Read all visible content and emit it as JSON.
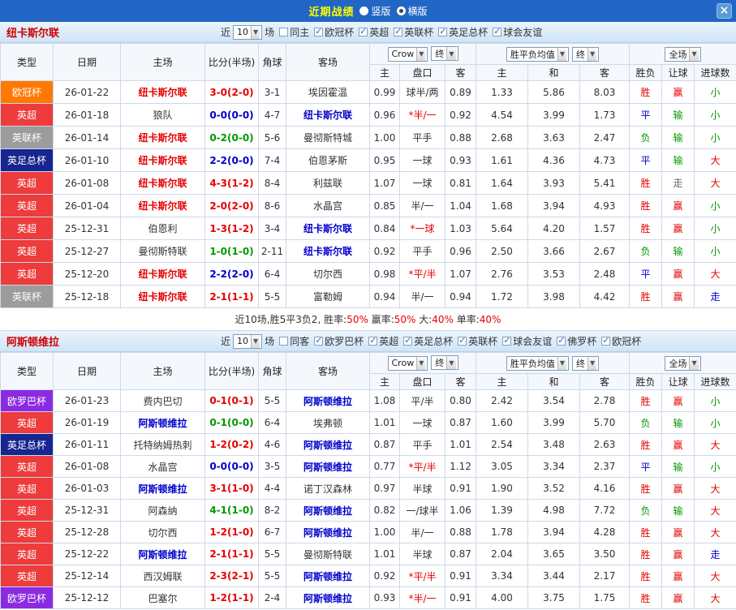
{
  "topbar": {
    "title": "近期战绩",
    "radios": [
      {
        "label": "竖版",
        "selected": false
      },
      {
        "label": "横版",
        "selected": true
      }
    ],
    "close_label": "×"
  },
  "colors": {
    "win_red": "#e60000",
    "draw_blue": "#0000cc",
    "loss_green": "#009900",
    "neutral": "#333333",
    "void_gray": "#666666"
  },
  "sections": [
    {
      "team": "纽卡斯尔联",
      "recent_prefix": "近",
      "recent_count": "10",
      "recent_suffix": "场",
      "same_filter": {
        "label": "同主",
        "checked": false
      },
      "cups": [
        {
          "label": "欧冠杯",
          "checked": true
        },
        {
          "label": "英超",
          "checked": true
        },
        {
          "label": "英联杯",
          "checked": true
        },
        {
          "label": "英足总杯",
          "checked": true
        },
        {
          "label": "球会友谊",
          "checked": true
        }
      ],
      "selects": {
        "bookmaker": "Crow",
        "ah_stage": "终",
        "avg_label": "胜平负均值",
        "avg_stage": "终",
        "scope": "全场"
      },
      "headers": {
        "type": "类型",
        "date": "日期",
        "home": "主场",
        "score": "比分(半场)",
        "corners": "角球",
        "away": "客场",
        "ah": [
          "主",
          "盘口",
          "客"
        ],
        "avg": [
          "主",
          "和",
          "客"
        ],
        "results": [
          "胜负",
          "让球",
          "进球数"
        ]
      },
      "rows": [
        {
          "comp": "欧冠杯",
          "comp_bg": "#ff7800",
          "date": "26-01-22",
          "home": "纽卡斯尔联",
          "home_color": "#e60000",
          "score": "3-0(2-0)",
          "score_color": "#e60000",
          "corners": "3-1",
          "away": "埃因霍温",
          "away_color": "#333333",
          "ah": [
            "0.99",
            "球半/两",
            "0.89"
          ],
          "ah_line_color": "#333333",
          "avg": [
            "1.33",
            "5.86",
            "8.03"
          ],
          "res": [
            [
              "胜",
              "#e60000"
            ],
            [
              "赢",
              "#e60000"
            ],
            [
              "小",
              "#009900"
            ]
          ]
        },
        {
          "comp": "英超",
          "comp_bg": "#ee3b3b",
          "date": "26-01-18",
          "home": "狼队",
          "home_color": "#333333",
          "score": "0-0(0-0)",
          "score_color": "#0000cc",
          "corners": "4-7",
          "away": "纽卡斯尔联",
          "away_color": "#0000cc",
          "ah": [
            "0.96",
            "*半/一",
            "0.92"
          ],
          "ah_line_color": "#e60000",
          "avg": [
            "4.54",
            "3.99",
            "1.73"
          ],
          "res": [
            [
              "平",
              "#0000cc"
            ],
            [
              "输",
              "#009900"
            ],
            [
              "小",
              "#009900"
            ]
          ]
        },
        {
          "comp": "英联杯",
          "comp_bg": "#9c9c9c",
          "date": "26-01-14",
          "home": "纽卡斯尔联",
          "home_color": "#e60000",
          "score": "0-2(0-0)",
          "score_color": "#009900",
          "corners": "5-6",
          "away": "曼彻斯特城",
          "away_color": "#333333",
          "ah": [
            "1.00",
            "平手",
            "0.88"
          ],
          "ah_line_color": "#333333",
          "avg": [
            "2.68",
            "3.63",
            "2.47"
          ],
          "res": [
            [
              "负",
              "#009900"
            ],
            [
              "输",
              "#009900"
            ],
            [
              "小",
              "#009900"
            ]
          ]
        },
        {
          "comp": "英足总杯",
          "comp_bg": "#16258f",
          "date": "26-01-10",
          "home": "纽卡斯尔联",
          "home_color": "#e60000",
          "score": "2-2(0-0)",
          "score_color": "#0000cc",
          "corners": "7-4",
          "away": "伯恩茅斯",
          "away_color": "#333333",
          "ah": [
            "0.95",
            "一球",
            "0.93"
          ],
          "ah_line_color": "#333333",
          "avg": [
            "1.61",
            "4.36",
            "4.73"
          ],
          "res": [
            [
              "平",
              "#0000cc"
            ],
            [
              "输",
              "#009900"
            ],
            [
              "大",
              "#e60000"
            ]
          ]
        },
        {
          "comp": "英超",
          "comp_bg": "#ee3b3b",
          "date": "26-01-08",
          "home": "纽卡斯尔联",
          "home_color": "#e60000",
          "score": "4-3(1-2)",
          "score_color": "#e60000",
          "corners": "8-4",
          "away": "利兹联",
          "away_color": "#333333",
          "ah": [
            "1.07",
            "一球",
            "0.81"
          ],
          "ah_line_color": "#333333",
          "avg": [
            "1.64",
            "3.93",
            "5.41"
          ],
          "res": [
            [
              "胜",
              "#e60000"
            ],
            [
              "走",
              "#666666"
            ],
            [
              "大",
              "#e60000"
            ]
          ]
        },
        {
          "comp": "英超",
          "comp_bg": "#ee3b3b",
          "date": "26-01-04",
          "home": "纽卡斯尔联",
          "home_color": "#e60000",
          "score": "2-0(2-0)",
          "score_color": "#e60000",
          "corners": "8-6",
          "away": "水晶宫",
          "away_color": "#333333",
          "ah": [
            "0.85",
            "半/一",
            "1.04"
          ],
          "ah_line_color": "#333333",
          "avg": [
            "1.68",
            "3.94",
            "4.93"
          ],
          "res": [
            [
              "胜",
              "#e60000"
            ],
            [
              "赢",
              "#e60000"
            ],
            [
              "小",
              "#009900"
            ]
          ]
        },
        {
          "comp": "英超",
          "comp_bg": "#ee3b3b",
          "date": "25-12-31",
          "home": "伯恩利",
          "home_color": "#333333",
          "score": "1-3(1-2)",
          "score_color": "#e60000",
          "corners": "3-4",
          "away": "纽卡斯尔联",
          "away_color": "#0000cc",
          "ah": [
            "0.84",
            "*一球",
            "1.03"
          ],
          "ah_line_color": "#e60000",
          "avg": [
            "5.64",
            "4.20",
            "1.57"
          ],
          "res": [
            [
              "胜",
              "#e60000"
            ],
            [
              "赢",
              "#e60000"
            ],
            [
              "小",
              "#009900"
            ]
          ]
        },
        {
          "comp": "英超",
          "comp_bg": "#ee3b3b",
          "date": "25-12-27",
          "home": "曼彻斯特联",
          "home_color": "#333333",
          "score": "1-0(1-0)",
          "score_color": "#009900",
          "corners": "2-11",
          "away": "纽卡斯尔联",
          "away_color": "#0000cc",
          "ah": [
            "0.92",
            "平手",
            "0.96"
          ],
          "ah_line_color": "#333333",
          "avg": [
            "2.50",
            "3.66",
            "2.67"
          ],
          "res": [
            [
              "负",
              "#009900"
            ],
            [
              "输",
              "#009900"
            ],
            [
              "小",
              "#009900"
            ]
          ]
        },
        {
          "comp": "英超",
          "comp_bg": "#ee3b3b",
          "date": "25-12-20",
          "home": "纽卡斯尔联",
          "home_color": "#e60000",
          "score": "2-2(2-0)",
          "score_color": "#0000cc",
          "corners": "6-4",
          "away": "切尔西",
          "away_color": "#333333",
          "ah": [
            "0.98",
            "*平/半",
            "1.07"
          ],
          "ah_line_color": "#e60000",
          "avg": [
            "2.76",
            "3.53",
            "2.48"
          ],
          "res": [
            [
              "平",
              "#0000cc"
            ],
            [
              "赢",
              "#e60000"
            ],
            [
              "大",
              "#e60000"
            ]
          ]
        },
        {
          "comp": "英联杯",
          "comp_bg": "#9c9c9c",
          "date": "25-12-18",
          "home": "纽卡斯尔联",
          "home_color": "#e60000",
          "score": "2-1(1-1)",
          "score_color": "#e60000",
          "corners": "5-5",
          "away": "富勒姆",
          "away_color": "#333333",
          "ah": [
            "0.94",
            "半/一",
            "0.94"
          ],
          "ah_line_color": "#333333",
          "avg": [
            "1.72",
            "3.98",
            "4.42"
          ],
          "res": [
            [
              "胜",
              "#e60000"
            ],
            [
              "赢",
              "#e60000"
            ],
            [
              "走",
              "#0000cc"
            ]
          ]
        }
      ],
      "summary": [
        [
          "近10场,胜5平3负2, 胜率:",
          "#333333"
        ],
        [
          "50%",
          "#e60000"
        ],
        [
          " 赢率:",
          "#333333"
        ],
        [
          "50%",
          "#e60000"
        ],
        [
          " 大:",
          "#333333"
        ],
        [
          "40%",
          "#e60000"
        ],
        [
          " 单率:",
          "#333333"
        ],
        [
          "40%",
          "#e60000"
        ]
      ]
    },
    {
      "team": "阿斯顿维拉",
      "recent_prefix": "近",
      "recent_count": "10",
      "recent_suffix": "场",
      "same_filter": {
        "label": "同客",
        "checked": false
      },
      "cups": [
        {
          "label": "欧罗巴杯",
          "checked": true
        },
        {
          "label": "英超",
          "checked": true
        },
        {
          "label": "英足总杯",
          "checked": true
        },
        {
          "label": "英联杯",
          "checked": true
        },
        {
          "label": "球会友谊",
          "checked": true
        },
        {
          "label": "佛罗杯",
          "checked": true
        },
        {
          "label": "欧冠杯",
          "checked": true
        }
      ],
      "selects": {
        "bookmaker": "Crow",
        "ah_stage": "终",
        "avg_label": "胜平负均值",
        "avg_stage": "终",
        "scope": "全场"
      },
      "headers": {
        "type": "类型",
        "date": "日期",
        "home": "主场",
        "score": "比分(半场)",
        "corners": "角球",
        "away": "客场",
        "ah": [
          "主",
          "盘口",
          "客"
        ],
        "avg": [
          "主",
          "和",
          "客"
        ],
        "results": [
          "胜负",
          "让球",
          "进球数"
        ]
      },
      "rows": [
        {
          "comp": "欧罗巴杯",
          "comp_bg": "#8a2be2",
          "date": "26-01-23",
          "home": "费内巴切",
          "home_color": "#333333",
          "score": "0-1(0-1)",
          "score_color": "#e60000",
          "corners": "5-5",
          "away": "阿斯顿维拉",
          "away_color": "#0000cc",
          "ah": [
            "1.08",
            "平/半",
            "0.80"
          ],
          "ah_line_color": "#333333",
          "avg": [
            "2.42",
            "3.54",
            "2.78"
          ],
          "res": [
            [
              "胜",
              "#e60000"
            ],
            [
              "赢",
              "#e60000"
            ],
            [
              "小",
              "#009900"
            ]
          ]
        },
        {
          "comp": "英超",
          "comp_bg": "#ee3b3b",
          "date": "26-01-19",
          "home": "阿斯顿维拉",
          "home_color": "#0000cc",
          "score": "0-1(0-0)",
          "score_color": "#009900",
          "corners": "6-4",
          "away": "埃弗顿",
          "away_color": "#333333",
          "ah": [
            "1.01",
            "一球",
            "0.87"
          ],
          "ah_line_color": "#333333",
          "avg": [
            "1.60",
            "3.99",
            "5.70"
          ],
          "res": [
            [
              "负",
              "#009900"
            ],
            [
              "输",
              "#009900"
            ],
            [
              "小",
              "#009900"
            ]
          ]
        },
        {
          "comp": "英足总杯",
          "comp_bg": "#16258f",
          "date": "26-01-11",
          "home": "托特纳姆热刺",
          "home_color": "#333333",
          "score": "1-2(0-2)",
          "score_color": "#e60000",
          "corners": "4-6",
          "away": "阿斯顿维拉",
          "away_color": "#0000cc",
          "ah": [
            "0.87",
            "平手",
            "1.01"
          ],
          "ah_line_color": "#333333",
          "avg": [
            "2.54",
            "3.48",
            "2.63"
          ],
          "res": [
            [
              "胜",
              "#e60000"
            ],
            [
              "赢",
              "#e60000"
            ],
            [
              "大",
              "#e60000"
            ]
          ]
        },
        {
          "comp": "英超",
          "comp_bg": "#ee3b3b",
          "date": "26-01-08",
          "home": "水晶宫",
          "home_color": "#333333",
          "score": "0-0(0-0)",
          "score_color": "#0000cc",
          "corners": "3-5",
          "away": "阿斯顿维拉",
          "away_color": "#0000cc",
          "ah": [
            "0.77",
            "*平/半",
            "1.12"
          ],
          "ah_line_color": "#e60000",
          "avg": [
            "3.05",
            "3.34",
            "2.37"
          ],
          "res": [
            [
              "平",
              "#0000cc"
            ],
            [
              "输",
              "#009900"
            ],
            [
              "小",
              "#009900"
            ]
          ]
        },
        {
          "comp": "英超",
          "comp_bg": "#ee3b3b",
          "date": "26-01-03",
          "home": "阿斯顿维拉",
          "home_color": "#0000cc",
          "score": "3-1(1-0)",
          "score_color": "#e60000",
          "corners": "4-4",
          "away": "诺丁汉森林",
          "away_color": "#333333",
          "ah": [
            "0.97",
            "半球",
            "0.91"
          ],
          "ah_line_color": "#333333",
          "avg": [
            "1.90",
            "3.52",
            "4.16"
          ],
          "res": [
            [
              "胜",
              "#e60000"
            ],
            [
              "赢",
              "#e60000"
            ],
            [
              "大",
              "#e60000"
            ]
          ]
        },
        {
          "comp": "英超",
          "comp_bg": "#ee3b3b",
          "date": "25-12-31",
          "home": "阿森纳",
          "home_color": "#333333",
          "score": "4-1(1-0)",
          "score_color": "#009900",
          "corners": "8-2",
          "away": "阿斯顿维拉",
          "away_color": "#0000cc",
          "ah": [
            "0.82",
            "一/球半",
            "1.06"
          ],
          "ah_line_color": "#333333",
          "avg": [
            "1.39",
            "4.98",
            "7.72"
          ],
          "res": [
            [
              "负",
              "#009900"
            ],
            [
              "输",
              "#009900"
            ],
            [
              "大",
              "#e60000"
            ]
          ]
        },
        {
          "comp": "英超",
          "comp_bg": "#ee3b3b",
          "date": "25-12-28",
          "home": "切尔西",
          "home_color": "#333333",
          "score": "1-2(1-0)",
          "score_color": "#e60000",
          "corners": "6-7",
          "away": "阿斯顿维拉",
          "away_color": "#0000cc",
          "ah": [
            "1.00",
            "半/一",
            "0.88"
          ],
          "ah_line_color": "#333333",
          "avg": [
            "1.78",
            "3.94",
            "4.28"
          ],
          "res": [
            [
              "胜",
              "#e60000"
            ],
            [
              "赢",
              "#e60000"
            ],
            [
              "大",
              "#e60000"
            ]
          ]
        },
        {
          "comp": "英超",
          "comp_bg": "#ee3b3b",
          "date": "25-12-22",
          "home": "阿斯顿维拉",
          "home_color": "#0000cc",
          "score": "2-1(1-1)",
          "score_color": "#e60000",
          "corners": "5-5",
          "away": "曼彻斯特联",
          "away_color": "#333333",
          "ah": [
            "1.01",
            "半球",
            "0.87"
          ],
          "ah_line_color": "#333333",
          "avg": [
            "2.04",
            "3.65",
            "3.50"
          ],
          "res": [
            [
              "胜",
              "#e60000"
            ],
            [
              "赢",
              "#e60000"
            ],
            [
              "走",
              "#0000cc"
            ]
          ]
        },
        {
          "comp": "英超",
          "comp_bg": "#ee3b3b",
          "date": "25-12-14",
          "home": "西汉姆联",
          "home_color": "#333333",
          "score": "2-3(2-1)",
          "score_color": "#e60000",
          "corners": "5-5",
          "away": "阿斯顿维拉",
          "away_color": "#0000cc",
          "ah": [
            "0.92",
            "*平/半",
            "0.91"
          ],
          "ah_line_color": "#e60000",
          "avg": [
            "3.34",
            "3.44",
            "2.17"
          ],
          "res": [
            [
              "胜",
              "#e60000"
            ],
            [
              "赢",
              "#e60000"
            ],
            [
              "大",
              "#e60000"
            ]
          ]
        },
        {
          "comp": "欧罗巴杯",
          "comp_bg": "#8a2be2",
          "date": "25-12-12",
          "home": "巴塞尔",
          "home_color": "#333333",
          "score": "1-2(1-1)",
          "score_color": "#e60000",
          "corners": "2-4",
          "away": "阿斯顿维拉",
          "away_color": "#0000cc",
          "ah": [
            "0.93",
            "*半/一",
            "0.91"
          ],
          "ah_line_color": "#e60000",
          "avg": [
            "4.00",
            "3.75",
            "1.75"
          ],
          "res": [
            [
              "胜",
              "#e60000"
            ],
            [
              "赢",
              "#e60000"
            ],
            [
              "大",
              "#e60000"
            ]
          ]
        }
      ],
      "summary": []
    }
  ]
}
